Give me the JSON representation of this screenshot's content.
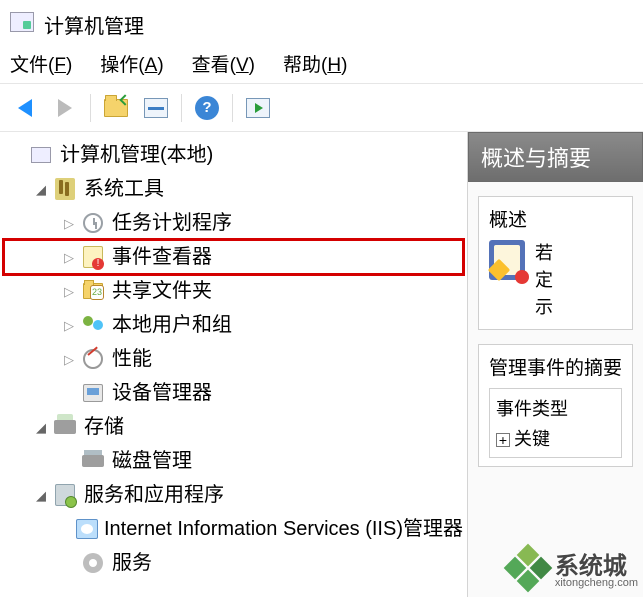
{
  "window": {
    "title": "计算机管理"
  },
  "menu": {
    "file": {
      "label": "文件",
      "mnemonic": "F"
    },
    "action": {
      "label": "操作",
      "mnemonic": "A"
    },
    "view": {
      "label": "查看",
      "mnemonic": "V"
    },
    "help": {
      "label": "帮助",
      "mnemonic": "H"
    }
  },
  "toolbar": {
    "back": "back-icon",
    "forward": "forward-icon",
    "up_folder": "up-folder-icon",
    "properties": "properties-panel-icon",
    "help": "help-icon",
    "action_pane": "action-pane-icon"
  },
  "tree": {
    "root": "计算机管理(本地)",
    "system_tools": "系统工具",
    "task_scheduler": "任务计划程序",
    "event_viewer": "事件查看器",
    "shared_folders": "共享文件夹",
    "local_users": "本地用户和组",
    "performance": "性能",
    "device_manager": "设备管理器",
    "storage": "存储",
    "disk_management": "磁盘管理",
    "services_apps": "服务和应用程序",
    "iis": "Internet Information Services (IIS)管理器",
    "services": "服务"
  },
  "right": {
    "header": "概述与摘要",
    "overview_title": "概述",
    "overview_line1": "若",
    "overview_line2": "定",
    "overview_line3": "示",
    "admin_events_title": "管理事件的摘要",
    "event_type_label": "事件类型",
    "critical_label": "关键"
  },
  "watermark": {
    "brand": "系统城",
    "url": "xitongcheng.com"
  }
}
